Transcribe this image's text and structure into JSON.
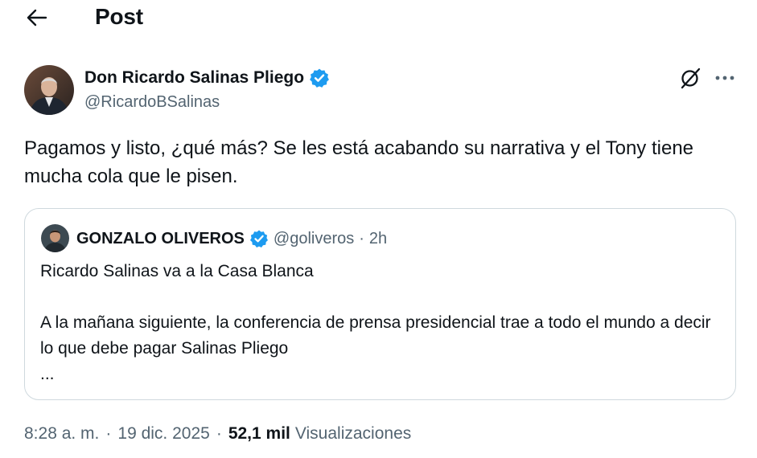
{
  "header": {
    "title": "Post",
    "back_icon": "arrow-left-icon"
  },
  "author": {
    "name": "Don Ricardo Salinas Pliego",
    "handle": "@RicardoBSalinas",
    "verified": true,
    "verified_color": "#1d9bf0"
  },
  "tweet": {
    "text": "Pagamos y listo, ¿qué más? Se les está acabando su narrativa y el Tony tiene mucha cola que le pisen."
  },
  "quote": {
    "name": "GONZALO OLIVEROS",
    "handle": "@goliveros",
    "separator": "·",
    "time": "2h",
    "lines": [
      "Ricardo Salinas va a la Casa Blanca",
      "",
      "A la mañana siguiente, la conferencia de prensa presidencial  trae a todo el mundo a decir lo que debe pagar Salinas Pliego",
      "..."
    ]
  },
  "meta": {
    "time": "8:28 a. m.",
    "sep1": "·",
    "date": "19 dic. 2025",
    "sep2": "·",
    "views_count": "52,1 mil",
    "views_label": "Visualizaciones"
  },
  "colors": {
    "text": "#0f1419",
    "secondary": "#536471",
    "border": "#cfd9de",
    "accent": "#1d9bf0"
  },
  "icons": [
    "arrow-left-icon",
    "verified-badge-icon",
    "grok-icon",
    "more-icon"
  ]
}
